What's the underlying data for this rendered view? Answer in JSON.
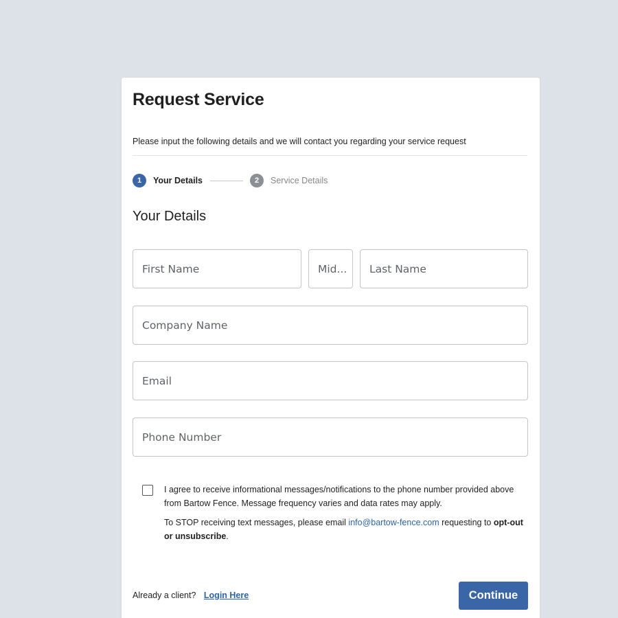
{
  "form": {
    "title": "Request Service",
    "subtitle": "Please input the following details and we will contact you regarding your service request",
    "section_title": "Your Details"
  },
  "stepper": {
    "steps": [
      {
        "number": "1",
        "label": "Your Details",
        "state": "active"
      },
      {
        "number": "2",
        "label": "Service Details",
        "state": "inactive"
      }
    ]
  },
  "fields": {
    "first_name": {
      "placeholder": "First Name",
      "value": ""
    },
    "middle_name": {
      "placeholder": "Mid...",
      "value": ""
    },
    "last_name": {
      "placeholder": "Last Name",
      "value": ""
    },
    "company_name": {
      "placeholder": "Company Name",
      "value": ""
    },
    "email": {
      "placeholder": "Email",
      "value": ""
    },
    "phone": {
      "placeholder": "Phone Number",
      "value": ""
    }
  },
  "consent": {
    "checked": false,
    "text": "I agree to receive informational messages/notifications to the phone number provided above from Bartow Fence. Message frequency varies and data rates may apply.",
    "stop_prefix": "To STOP receiving text messages, please email ",
    "stop_email": "info@bartow-fence.com",
    "stop_middle": " requesting to ",
    "stop_bold": "opt-out or unsubscribe",
    "stop_suffix": "."
  },
  "footer": {
    "already_client": "Already a client?",
    "login_label": "Login Here",
    "continue_label": "Continue"
  },
  "colors": {
    "accent": "#3a66a7",
    "link": "#2b63a8",
    "background": "#dde1e8"
  }
}
